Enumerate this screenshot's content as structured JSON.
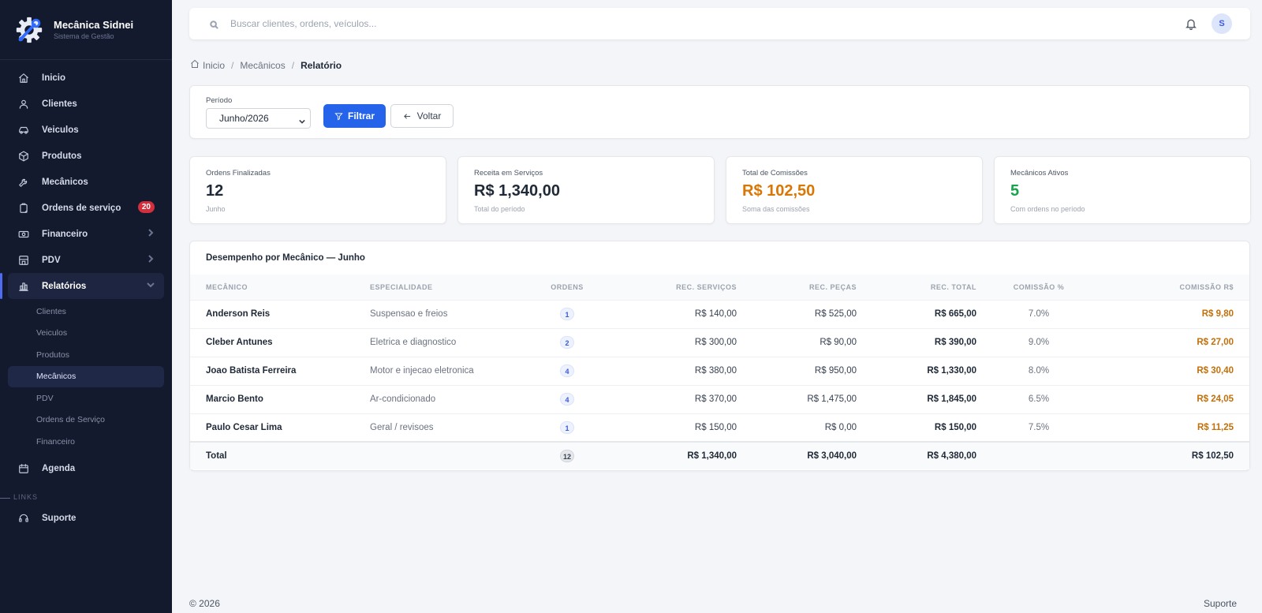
{
  "brand": {
    "name": "Mecânica Sidnei",
    "subtitle": "Sistema de Gestão"
  },
  "sidebar": {
    "items": [
      {
        "label": "Inicio",
        "icon": "home-icon"
      },
      {
        "label": "Clientes",
        "icon": "user-icon"
      },
      {
        "label": "Veiculos",
        "icon": "car-icon"
      },
      {
        "label": "Produtos",
        "icon": "box-icon"
      },
      {
        "label": "Mecânicos",
        "icon": "wrench-icon"
      },
      {
        "label": "Ordens de serviço",
        "icon": "clipboard-icon",
        "badge": "20"
      },
      {
        "label": "Financeiro",
        "icon": "money-icon"
      },
      {
        "label": "PDV",
        "icon": "store-icon"
      },
      {
        "label": "Relatórios",
        "icon": "chart-icon"
      }
    ],
    "report_sub": [
      "Clientes",
      "Veiculos",
      "Produtos",
      "Mecânicos",
      "PDV",
      "Ordens de Serviço",
      "Financeiro"
    ],
    "agenda": "Agenda",
    "links_label": "LINKS",
    "support": "Suporte"
  },
  "search": {
    "placeholder": "Buscar clientes, ordens, veículos..."
  },
  "user": {
    "initial": "S"
  },
  "breadcrumb": {
    "home": "Inicio",
    "section": "Mecânicos",
    "current": "Relatório"
  },
  "filter": {
    "period_label": "Período",
    "period_value": "Junho/2026",
    "filter_button": "Filtrar",
    "back_button": "Voltar"
  },
  "stats": [
    {
      "label": "Ordens Finalizadas",
      "value": "12",
      "sub": "Junho",
      "color": "#1f2937"
    },
    {
      "label": "Receita em Serviços",
      "value": "R$ 1,340,00",
      "sub": "Total do período",
      "color": "#1f2937"
    },
    {
      "label": "Total de Comissões",
      "value": "R$ 102,50",
      "sub": "Soma das comissões",
      "color": "#d97706"
    },
    {
      "label": "Mecânicos Ativos",
      "value": "5",
      "sub": "Com ordens no período",
      "color": "#16a34a"
    }
  ],
  "table": {
    "title": "Desempenho por Mecânico — Junho",
    "headers": [
      "Mecânico",
      "Especialidade",
      "Ordens",
      "Rec. Serviços",
      "Rec. Peças",
      "Rec. Total",
      "Comissão %",
      "Comissão R$"
    ],
    "rows": [
      {
        "name": "Anderson Reis",
        "spec": "Suspensao e freios",
        "orders": "1",
        "services": "R$ 140,00",
        "parts": "R$ 525,00",
        "total": "R$ 665,00",
        "pct": "7.0%",
        "commission": "R$ 9,80"
      },
      {
        "name": "Cleber Antunes",
        "spec": "Eletrica e diagnostico",
        "orders": "2",
        "services": "R$ 300,00",
        "parts": "R$ 90,00",
        "total": "R$ 390,00",
        "pct": "9.0%",
        "commission": "R$ 27,00"
      },
      {
        "name": "Joao Batista Ferreira",
        "spec": "Motor e injecao eletronica",
        "orders": "4",
        "services": "R$ 380,00",
        "parts": "R$ 950,00",
        "total": "R$ 1,330,00",
        "pct": "8.0%",
        "commission": "R$ 30,40"
      },
      {
        "name": "Marcio Bento",
        "spec": "Ar-condicionado",
        "orders": "4",
        "services": "R$ 370,00",
        "parts": "R$ 1,475,00",
        "total": "R$ 1,845,00",
        "pct": "6.5%",
        "commission": "R$ 24,05"
      },
      {
        "name": "Paulo Cesar Lima",
        "spec": "Geral / revisoes",
        "orders": "1",
        "services": "R$ 150,00",
        "parts": "R$ 0,00",
        "total": "R$ 150,00",
        "pct": "7.5%",
        "commission": "R$ 11,25"
      }
    ],
    "total": {
      "label": "Total",
      "orders": "12",
      "services": "R$ 1,340,00",
      "parts": "R$ 3,040,00",
      "total": "R$ 4,380,00",
      "commission": "R$ 102,50"
    }
  },
  "footer": {
    "copyright": "© 2026",
    "support": "Suporte"
  }
}
